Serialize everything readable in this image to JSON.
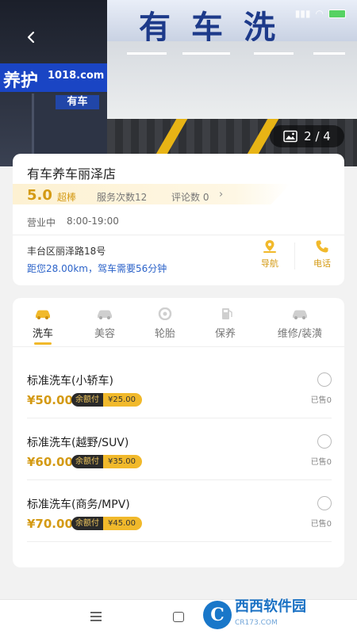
{
  "hero": {
    "sign_text": "有车洗",
    "left_sign_text": "养护",
    "left_sign_brand": "1018.com",
    "left_store_text": "有车",
    "counter": "2 / 4"
  },
  "store": {
    "name": "有车养车丽泽店",
    "score": "5.0",
    "score_word": "超棒",
    "service_count": "服务次数12",
    "review_count": "评论数 0",
    "hours_status": "营业中",
    "hours_time": "8:00-19:00",
    "address": "丰台区丽泽路18号",
    "distance": "距您28.00km，驾车需要56分钟",
    "nav_label": "导航",
    "call_label": "电话",
    "accent_color": "#d49a14"
  },
  "tabs": [
    {
      "label": "洗车",
      "icon": "car-wash-icon",
      "active": true
    },
    {
      "label": "美容",
      "icon": "car-beauty-icon",
      "active": false
    },
    {
      "label": "轮胎",
      "icon": "tire-icon",
      "active": false
    },
    {
      "label": "保养",
      "icon": "maintenance-icon",
      "active": false
    },
    {
      "label": "维修/装潢",
      "icon": "repair-icon",
      "active": false
    }
  ],
  "services": [
    {
      "name": "标准洗车(小轿车)",
      "price": "¥50.00",
      "badge_label": "余额付",
      "badge_value": "¥25.00",
      "sold": "已售0"
    },
    {
      "name": "标准洗车(越野/SUV)",
      "price": "¥60.00",
      "badge_label": "余额付",
      "badge_value": "¥35.00",
      "sold": "已售0"
    },
    {
      "name": "标准洗车(商务/MPV)",
      "price": "¥70.00",
      "badge_label": "余额付",
      "badge_value": "¥45.00",
      "sold": "已售0"
    }
  ],
  "watermark": {
    "logo_letter": "C",
    "name": "西西软件园",
    "url": "CR173.COM"
  }
}
